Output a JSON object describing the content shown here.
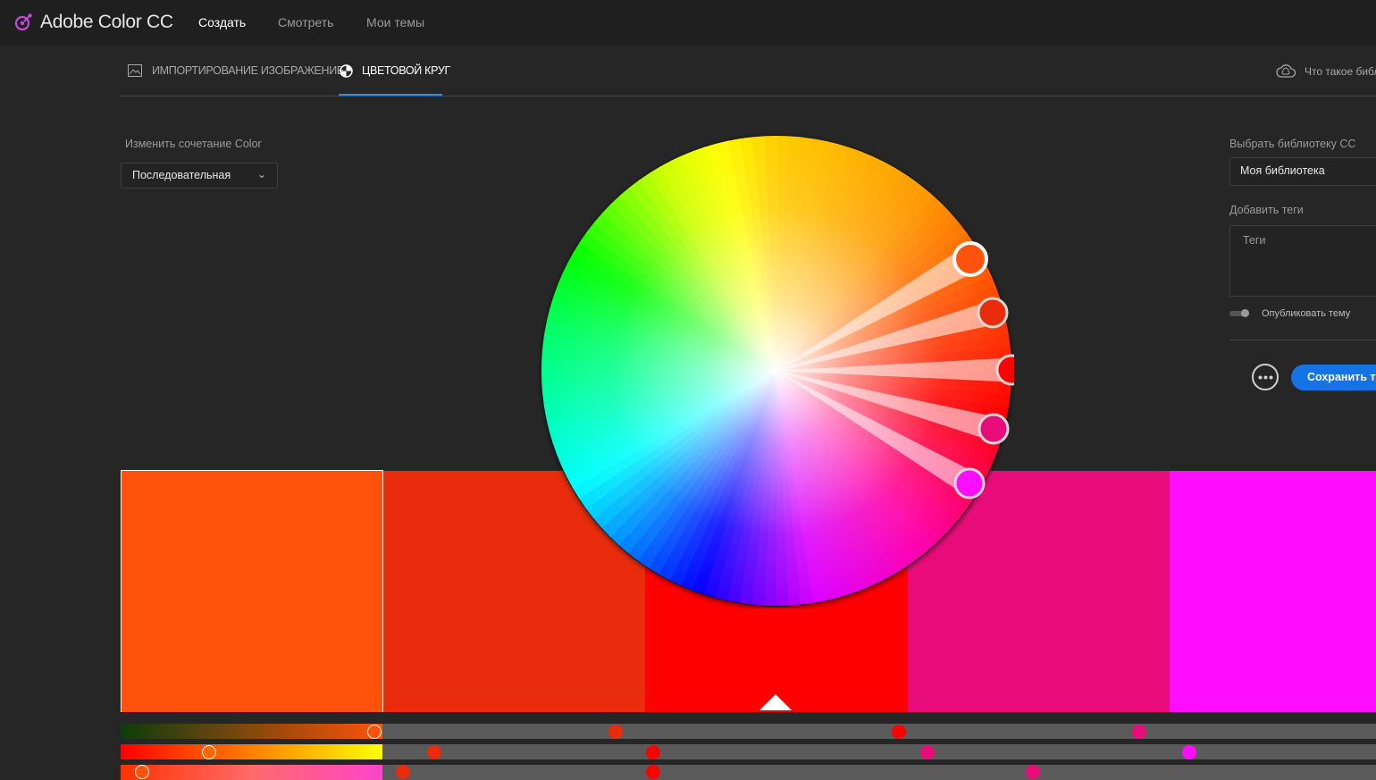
{
  "app": {
    "title": "Adobe Color CC",
    "nav": [
      {
        "label": "Создать",
        "active": true
      },
      {
        "label": "Смотреть",
        "active": false
      },
      {
        "label": "Мои темы",
        "active": false
      }
    ]
  },
  "tabs": [
    {
      "label": "ИМПОРТИРОВАНИЕ ИЗОБРАЖЕНИЕ",
      "icon": "image-icon",
      "active": false
    },
    {
      "label": "ЦВЕТОВОЙ КРУГ",
      "icon": "color-wheel-icon",
      "active": true
    }
  ],
  "help_link": "Что такое библ",
  "left_panel": {
    "rule_label": "Изменить сочетание Color",
    "rule_value": "Последовательная",
    "chevron": "⌄"
  },
  "right_panel": {
    "library_label": "Выбрать библиотеку CC",
    "library_value": "Моя библиотека",
    "tags_label": "Добавить теги",
    "tags_placeholder": "Теги",
    "publish_label": "Опубликовать тему",
    "publish_enabled": false,
    "save_label": "Сохранить тему",
    "more_icon": "more-icon"
  },
  "swatches": [
    "#FF530D",
    "#E82C0C",
    "#FF0000",
    "#E80C7A",
    "#FF0DFF"
  ],
  "selected_swatch_index": 0,
  "colors": {
    "accent": "#1473E6",
    "tab_underline": "#2B8CE0"
  }
}
